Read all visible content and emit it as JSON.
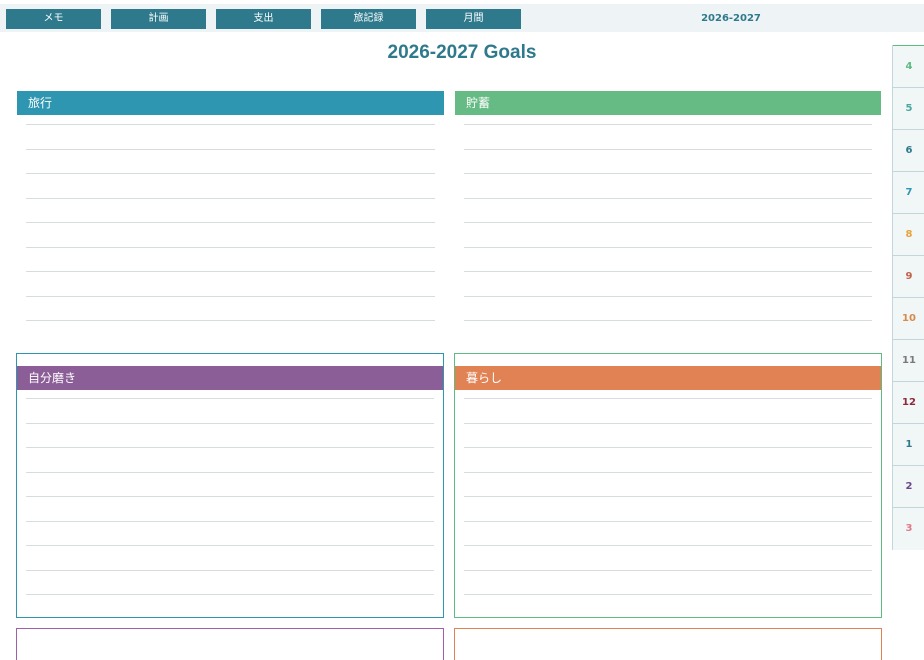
{
  "nav": {
    "items": [
      {
        "label": "メモ"
      },
      {
        "label": "計画"
      },
      {
        "label": "支出"
      },
      {
        "label": "旅記録"
      },
      {
        "label": "月間"
      }
    ],
    "current": "2026-2027"
  },
  "title": "2026-2027 Goals",
  "sections": {
    "travel": {
      "label": "旅行",
      "color": "#2e96b0"
    },
    "savings": {
      "label": "貯蓄",
      "color": "#66bb84"
    },
    "self_improvement": {
      "label": "自分磨き",
      "color": "#8b5e97",
      "border_color": "#2e96b0"
    },
    "living": {
      "label": "暮らし",
      "color": "#e08254",
      "border_color": "#5ebc82"
    },
    "bottom_left": {
      "border_color": "#a05fa8"
    },
    "bottom_right": {
      "border_color": "#e08254"
    }
  },
  "months": [
    {
      "label": "4",
      "color": "#5ebc82"
    },
    {
      "label": "5",
      "color": "#4aa8a0"
    },
    {
      "label": "6",
      "color": "#2e7a8c"
    },
    {
      "label": "7",
      "color": "#2e96b0"
    },
    {
      "label": "8",
      "color": "#e8a33a"
    },
    {
      "label": "9",
      "color": "#c0624a"
    },
    {
      "label": "10",
      "color": "#d98a4a"
    },
    {
      "label": "11",
      "color": "#7a7a7a"
    },
    {
      "label": "12",
      "color": "#8a2a3a"
    },
    {
      "label": "1",
      "color": "#2e7a8c"
    },
    {
      "label": "2",
      "color": "#6a4a8a"
    },
    {
      "label": "3",
      "color": "#e07a8a"
    }
  ]
}
